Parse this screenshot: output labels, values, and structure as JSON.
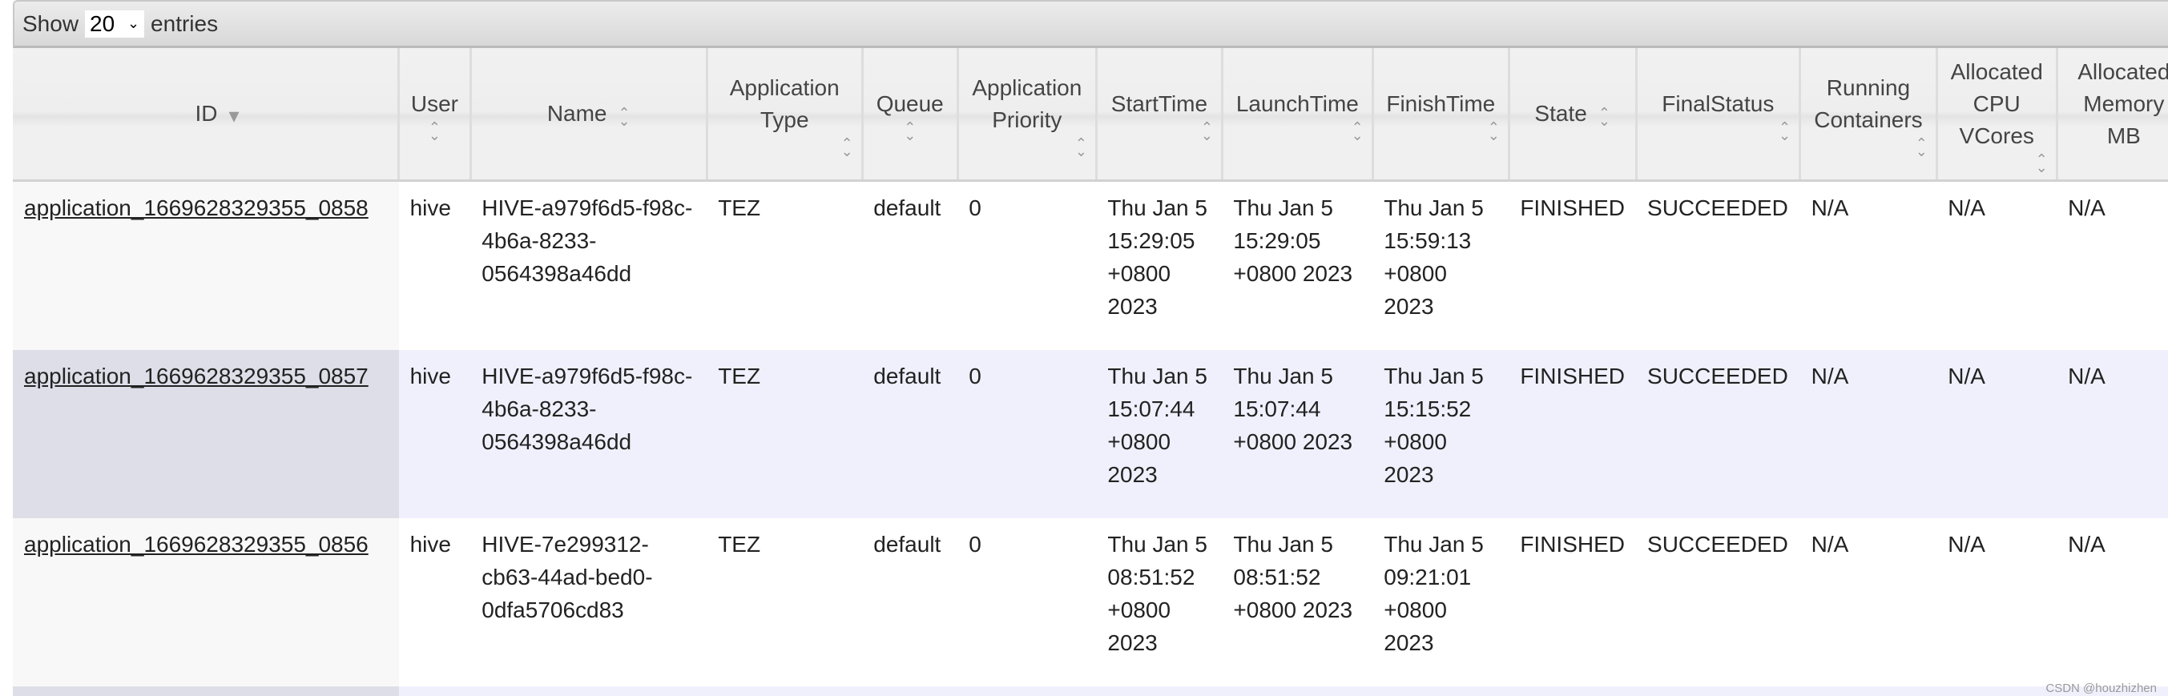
{
  "length_control": {
    "show": "Show",
    "value": "20",
    "entries": "entries"
  },
  "columns": [
    {
      "label": "ID",
      "sort": "sorted-desc"
    },
    {
      "label": "User",
      "sort": "unsorted"
    },
    {
      "label": "Name",
      "sort": "unsorted"
    },
    {
      "label": "Application Type",
      "sort": "unsorted"
    },
    {
      "label": "Queue",
      "sort": "unsorted"
    },
    {
      "label": "Application Priority",
      "sort": "unsorted"
    },
    {
      "label": "StartTime",
      "sort": "unsorted"
    },
    {
      "label": "LaunchTime",
      "sort": "unsorted"
    },
    {
      "label": "FinishTime",
      "sort": "unsorted"
    },
    {
      "label": "State",
      "sort": "unsorted"
    },
    {
      "label": "FinalStatus",
      "sort": "unsorted"
    },
    {
      "label": "Running Containers",
      "sort": "unsorted"
    },
    {
      "label": "Allocated CPU VCores",
      "sort": "unsorted"
    },
    {
      "label": "Allocated Memory MB",
      "sort": "unsorted"
    }
  ],
  "rows": [
    [
      "application_1669628329355_0858",
      "hive",
      "HIVE-a979f6d5-f98c-4b6a-8233-0564398a46dd",
      "TEZ",
      "default",
      "0",
      "Thu Jan 5 15:29:05 +0800 2023",
      "Thu Jan 5 15:29:05 +0800 2023",
      "Thu Jan 5 15:59:13 +0800 2023",
      "FINISHED",
      "SUCCEEDED",
      "N/A",
      "N/A",
      "N/A"
    ],
    [
      "application_1669628329355_0857",
      "hive",
      "HIVE-a979f6d5-f98c-4b6a-8233-0564398a46dd",
      "TEZ",
      "default",
      "0",
      "Thu Jan 5 15:07:44 +0800 2023",
      "Thu Jan 5 15:07:44 +0800 2023",
      "Thu Jan 5 15:15:52 +0800 2023",
      "FINISHED",
      "SUCCEEDED",
      "N/A",
      "N/A",
      "N/A"
    ],
    [
      "application_1669628329355_0856",
      "hive",
      "HIVE-7e299312-cb63-44ad-bed0-0dfa5706cd83",
      "TEZ",
      "default",
      "0",
      "Thu Jan 5 08:51:52 +0800 2023",
      "Thu Jan 5 08:51:52 +0800 2023",
      "Thu Jan 5 09:21:01 +0800 2023",
      "FINISHED",
      "SUCCEEDED",
      "N/A",
      "N/A",
      "N/A"
    ]
  ],
  "watermark": "CSDN @houzhizhen"
}
